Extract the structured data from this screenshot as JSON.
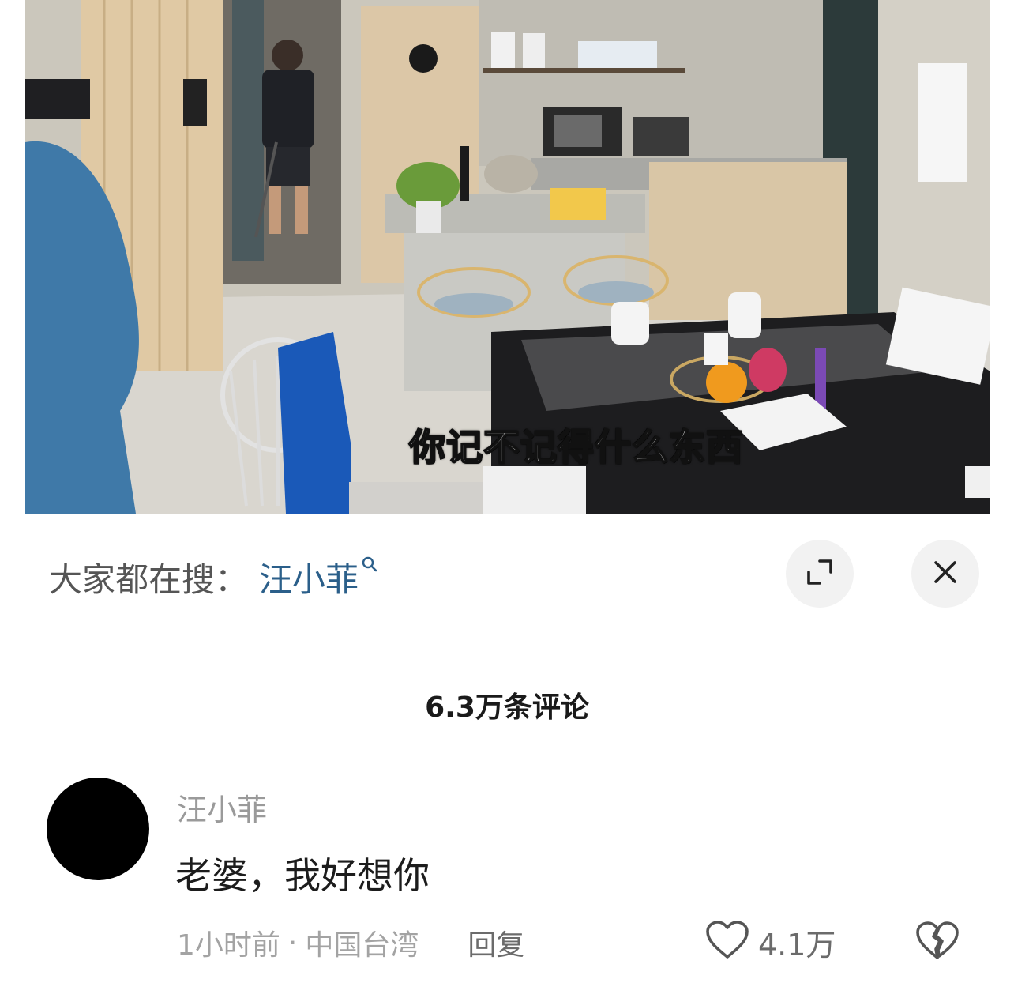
{
  "video": {
    "subtitle": "你记不记得什么东西"
  },
  "search_bar": {
    "prefix": "大家都在搜：",
    "term": "汪小菲",
    "term_icon": "search-icon"
  },
  "controls": {
    "expand_icon": "expand-icon",
    "close_icon": "close-icon"
  },
  "comments_header": {
    "count_label": "6.3万条评论"
  },
  "comment": {
    "username": "汪小菲",
    "text": "老婆，我好想你",
    "time": "1小时前",
    "separator": "·",
    "location": "中国台湾",
    "reply_label": "回复",
    "like_icon": "heart-icon",
    "likes": "4.1万",
    "dislike_icon": "broken-heart-icon"
  },
  "colors": {
    "search_term": "#2b5f8a",
    "secondary_text": "#9a9a9a",
    "primary_text": "#1c1c1c"
  }
}
